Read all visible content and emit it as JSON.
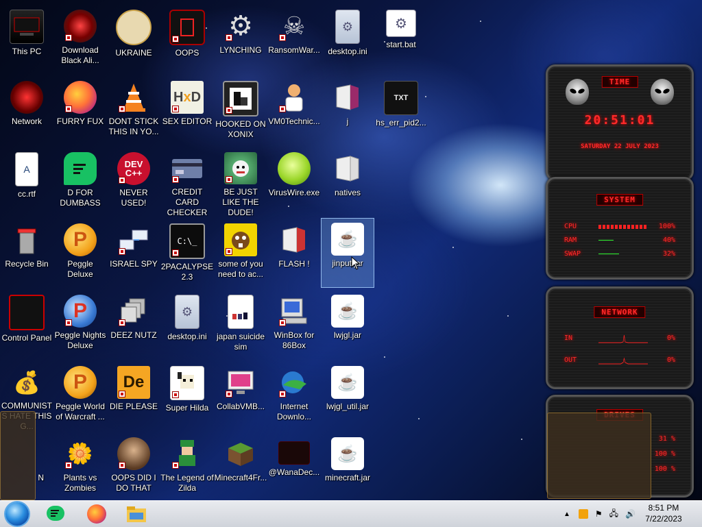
{
  "desktop": {
    "icons": [
      {
        "label": "This PC",
        "icon": "computer-icon"
      },
      {
        "label": "Download Black Ali...",
        "icon": "eye-icon"
      },
      {
        "label": "UKRAINE",
        "icon": "character-icon"
      },
      {
        "label": "OOPS",
        "icon": "red-device-icon"
      },
      {
        "label": "LYNCHING",
        "icon": "gear-icon"
      },
      {
        "label": "RansomWar...",
        "icon": "skull-icon"
      },
      {
        "label": "desktop.ini",
        "icon": "settings-file-icon"
      },
      {
        "label": "start.bat",
        "icon": "batch-file-icon"
      },
      {
        "label": "Network",
        "icon": "network-icon"
      },
      {
        "label": "FURRY FUX",
        "icon": "firefox-icon"
      },
      {
        "label": "DONT STICK THIS IN YO...",
        "icon": "vlc-cone-icon"
      },
      {
        "label": "SEX EDITOR",
        "icon": "hxd-icon"
      },
      {
        "label": "HOOKED ON XONIX",
        "icon": "xonix-icon"
      },
      {
        "label": "VM0Technic...",
        "icon": "person-icon"
      },
      {
        "label": "j",
        "icon": "folder-icon"
      },
      {
        "label": "hs_err_pid2...",
        "icon": "text-file-icon"
      },
      {
        "label": "cc.rtf",
        "icon": "rtf-file-icon"
      },
      {
        "label": "D FOR DUMBASS",
        "icon": "chat-icon"
      },
      {
        "label": "NEVER USED!",
        "icon": "devcpp-icon"
      },
      {
        "label": "CREDIT CARD CHECKER",
        "icon": "credit-card-icon"
      },
      {
        "label": "BE JUST LIKE THE DUDE!",
        "icon": "dude-icon"
      },
      {
        "label": "VirusWire.exe",
        "icon": "limewire-icon"
      },
      {
        "label": "natives",
        "icon": "folder-icon"
      },
      {
        "label": "Recycle Bin",
        "icon": "recycle-bin-icon"
      },
      {
        "label": "Peggle Deluxe",
        "icon": "peggle-icon"
      },
      {
        "label": "ISRAEL SPY",
        "icon": "network-spy-icon"
      },
      {
        "label": "2PACALYPSE 2.3",
        "icon": "terminal-icon"
      },
      {
        "label": "some of you need to ac...",
        "icon": "beaver-icon"
      },
      {
        "label": "FLASH !",
        "icon": "folder-icon"
      },
      {
        "label": "jinput.jar",
        "icon": "java-icon"
      },
      {
        "label": "Control Panel",
        "icon": "control-panel-icon"
      },
      {
        "label": "Peggle Nights Deluxe",
        "icon": "peggle-icon"
      },
      {
        "label": "DEEZ NUTZ",
        "icon": "windows-stack-icon"
      },
      {
        "label": "desktop.ini",
        "icon": "settings-file-icon"
      },
      {
        "label": "japan suicide sim",
        "icon": "document-icon"
      },
      {
        "label": "WinBox for 86Box",
        "icon": "winbox-icon"
      },
      {
        "label": "lwjgl.jar",
        "icon": "java-icon"
      },
      {
        "label": "COMMUNISTS HATE THIS G...",
        "icon": "money-bag-icon"
      },
      {
        "label": "Peggle World of Warcraft ...",
        "icon": "peggle-icon"
      },
      {
        "label": "DIE PLEASE",
        "icon": "die-icon"
      },
      {
        "label": "Super Hilda",
        "icon": "pixel-icon"
      },
      {
        "label": "CollabVMB...",
        "icon": "monitor-icon"
      },
      {
        "label": "Internet Downlo...",
        "icon": "idm-icon"
      },
      {
        "label": "lwjgl_util.jar",
        "icon": "java-icon"
      },
      {
        "label": "N",
        "icon": "partial-icon"
      },
      {
        "label": "Plants vs Zombies",
        "icon": "flower-icon"
      },
      {
        "label": "OOPS DID I DO THAT",
        "icon": "portrait-icon"
      },
      {
        "label": "The Legend of Zilda",
        "icon": "zelda-icon"
      },
      {
        "label": "Minecraft4Fr...",
        "icon": "grass-block-icon"
      },
      {
        "label": "@WanaDec...",
        "icon": "dark-window-icon"
      },
      {
        "label": "minecraft.jar",
        "icon": "java-icon"
      }
    ]
  },
  "gadget": {
    "time": {
      "title": "TIME",
      "clock": "20:51:01",
      "date": "SATURDAY 22 JULY 2023"
    },
    "system": {
      "title": "SYSTEM",
      "rows": [
        {
          "label": "CPU",
          "value": "100%",
          "level": 1.0
        },
        {
          "label": "RAM",
          "value": "40%",
          "level": 0.4
        },
        {
          "label": "SWAP",
          "value": "32%",
          "level": 0.32
        }
      ]
    },
    "network": {
      "title": "NETWORK",
      "rows": [
        {
          "label": "IN",
          "value": "0%"
        },
        {
          "label": "OUT",
          "value": "0%"
        }
      ]
    },
    "drives": {
      "title": "DRIVES",
      "rows": [
        {
          "value": "31 %"
        },
        {
          "value": "100 %"
        },
        {
          "value": "100 %"
        }
      ]
    }
  },
  "taskbar": {
    "clock_time": "8:51 PM",
    "clock_date": "7/22/2023",
    "apps": [
      "chat-app-icon",
      "firefox-icon",
      "file-explorer-icon"
    ]
  }
}
